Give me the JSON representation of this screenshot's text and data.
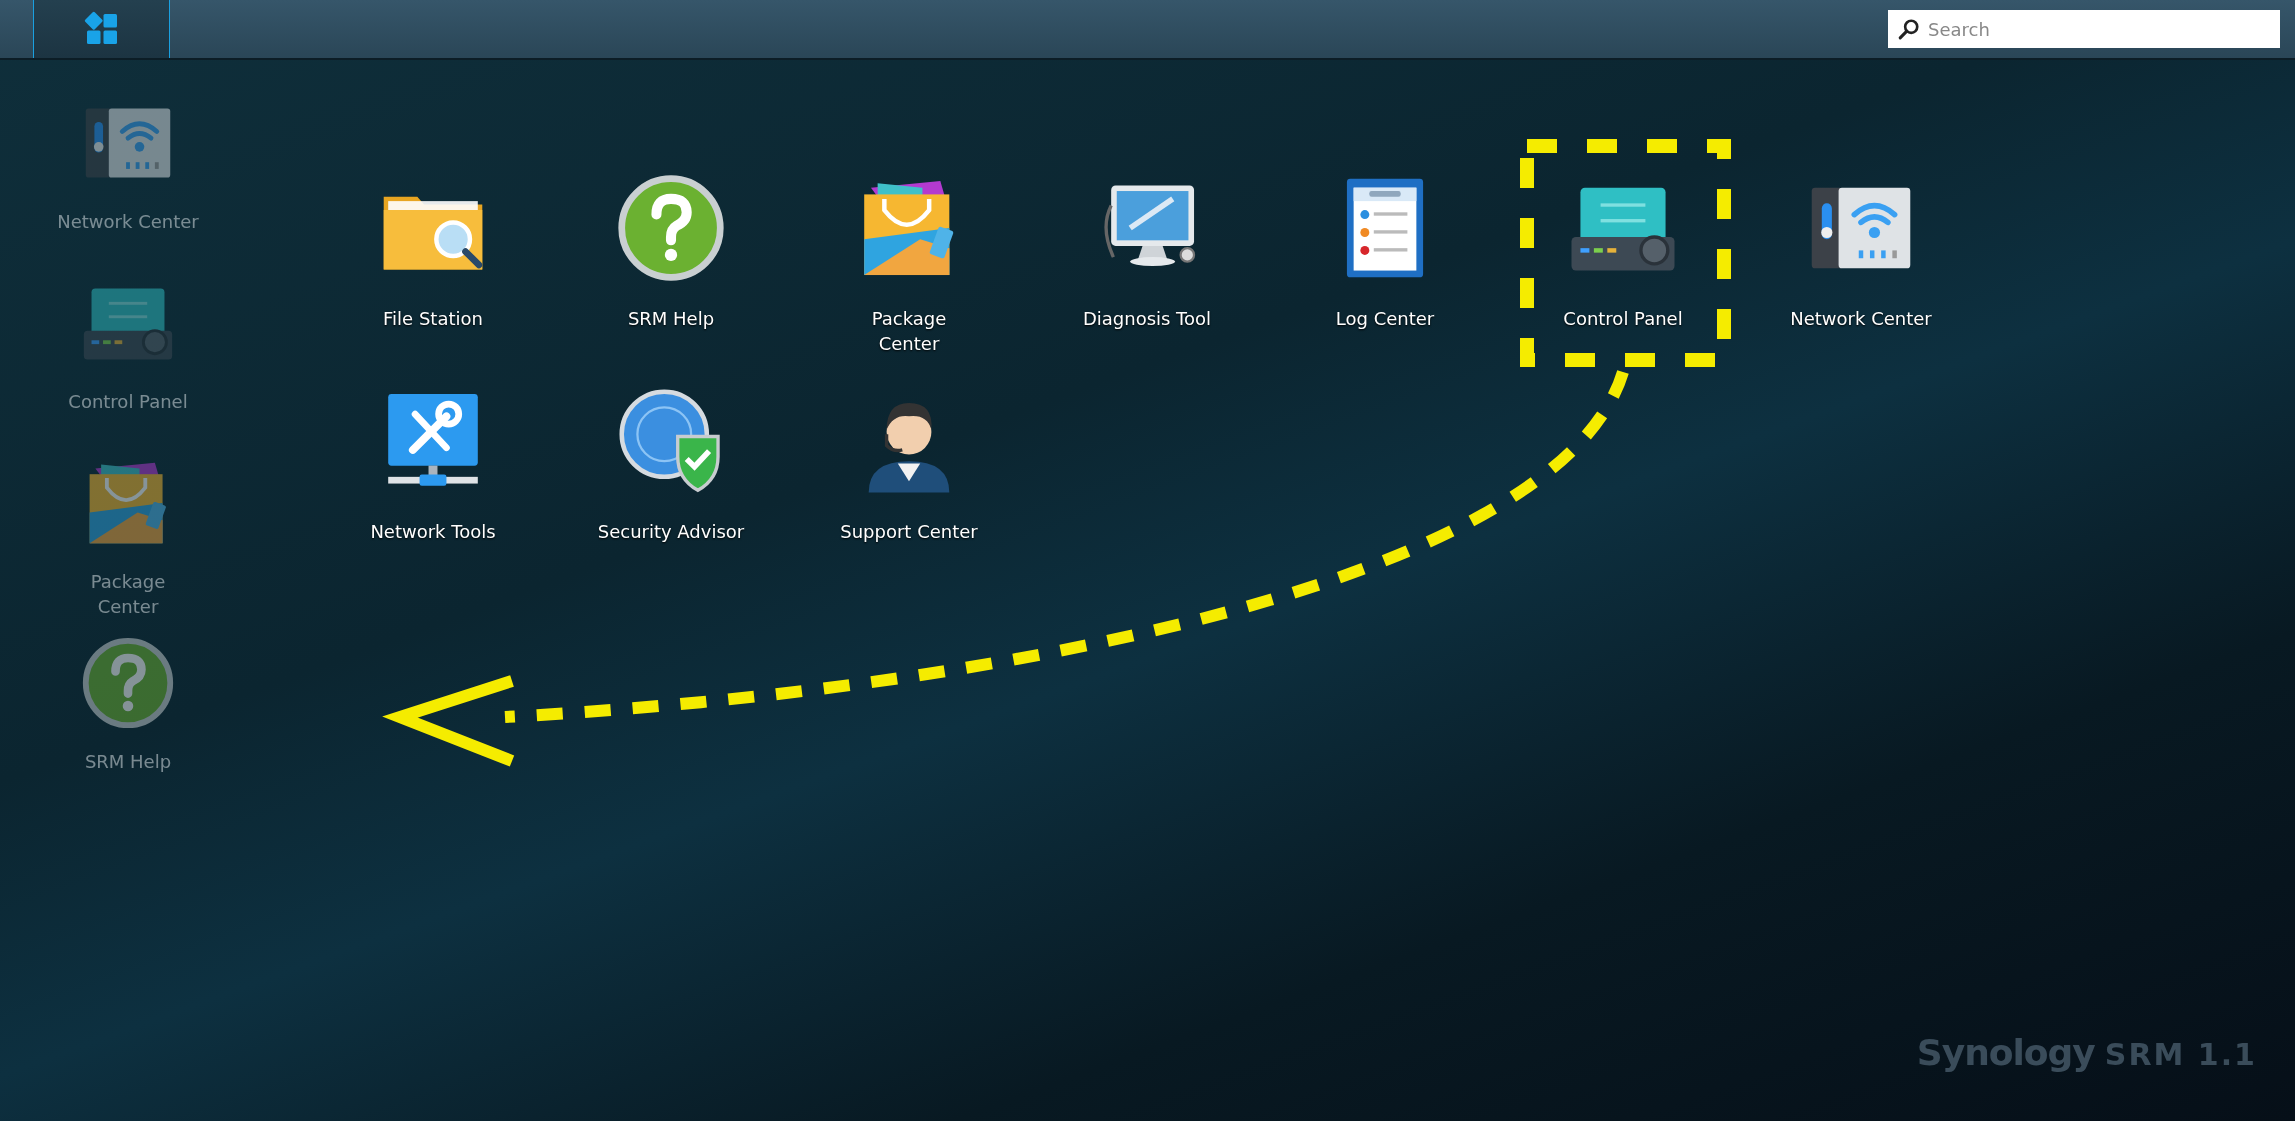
{
  "taskbar": {
    "search": {
      "placeholder": "Search"
    }
  },
  "desktop_shortcuts": [
    {
      "kind": "network",
      "lines": [
        "Network Center"
      ]
    },
    {
      "kind": "control",
      "lines": [
        "Control Panel"
      ]
    },
    {
      "kind": "package",
      "lines": [
        "Package",
        "Center"
      ]
    },
    {
      "kind": "help",
      "lines": [
        "SRM Help"
      ]
    }
  ],
  "main_menu": {
    "apps": [
      {
        "kind": "folder",
        "lines": [
          "File Station"
        ]
      },
      {
        "kind": "help",
        "lines": [
          "SRM Help"
        ]
      },
      {
        "kind": "package",
        "lines": [
          "Package",
          "Center"
        ]
      },
      {
        "kind": "diagnosis",
        "lines": [
          "Diagnosis Tool"
        ]
      },
      {
        "kind": "log",
        "lines": [
          "Log Center"
        ]
      },
      {
        "kind": "control",
        "lines": [
          "Control Panel"
        ]
      },
      {
        "kind": "network",
        "lines": [
          "Network Center"
        ]
      },
      {
        "kind": "tools",
        "lines": [
          "Network Tools"
        ]
      },
      {
        "kind": "security",
        "lines": [
          "Security Advisor"
        ]
      },
      {
        "kind": "support",
        "lines": [
          "Support Center"
        ]
      }
    ]
  },
  "branding": {
    "brand": "Synology",
    "product": "SRM 1.1"
  }
}
